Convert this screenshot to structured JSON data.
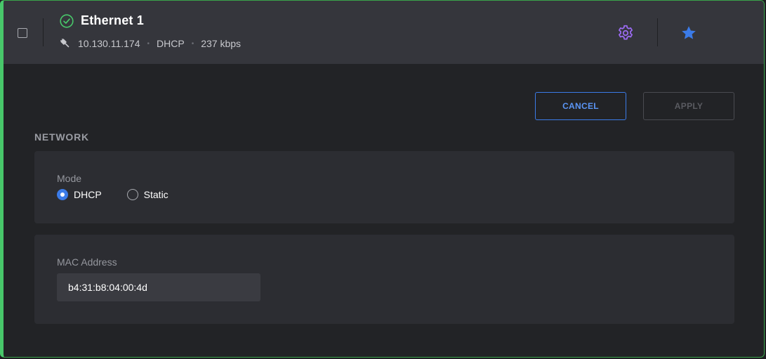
{
  "header": {
    "status_icon": "check-circle-icon",
    "title": "Ethernet 1",
    "connection_icon": "ethernet-plug-icon",
    "ip_address": "10.130.11.174",
    "separator": "•",
    "mode": "DHCP",
    "speed": "237 kbps",
    "settings_icon": "gear-icon",
    "favorite_icon": "star-icon"
  },
  "actions": {
    "cancel_label": "CANCEL",
    "apply_label": "APPLY"
  },
  "network": {
    "section_title": "NETWORK",
    "mode_label": "Mode",
    "mode_options": [
      {
        "label": "DHCP",
        "selected": true
      },
      {
        "label": "Static",
        "selected": false
      }
    ],
    "mac_label": "MAC Address",
    "mac_value": "b4:31:b8:04:00:4d"
  },
  "colors": {
    "accent_green": "#48c76a",
    "accent_blue": "#3b7be8",
    "gear_purple": "#9b6bf2",
    "header_bg": "#35363c",
    "panel_bg": "#2c2d32"
  }
}
